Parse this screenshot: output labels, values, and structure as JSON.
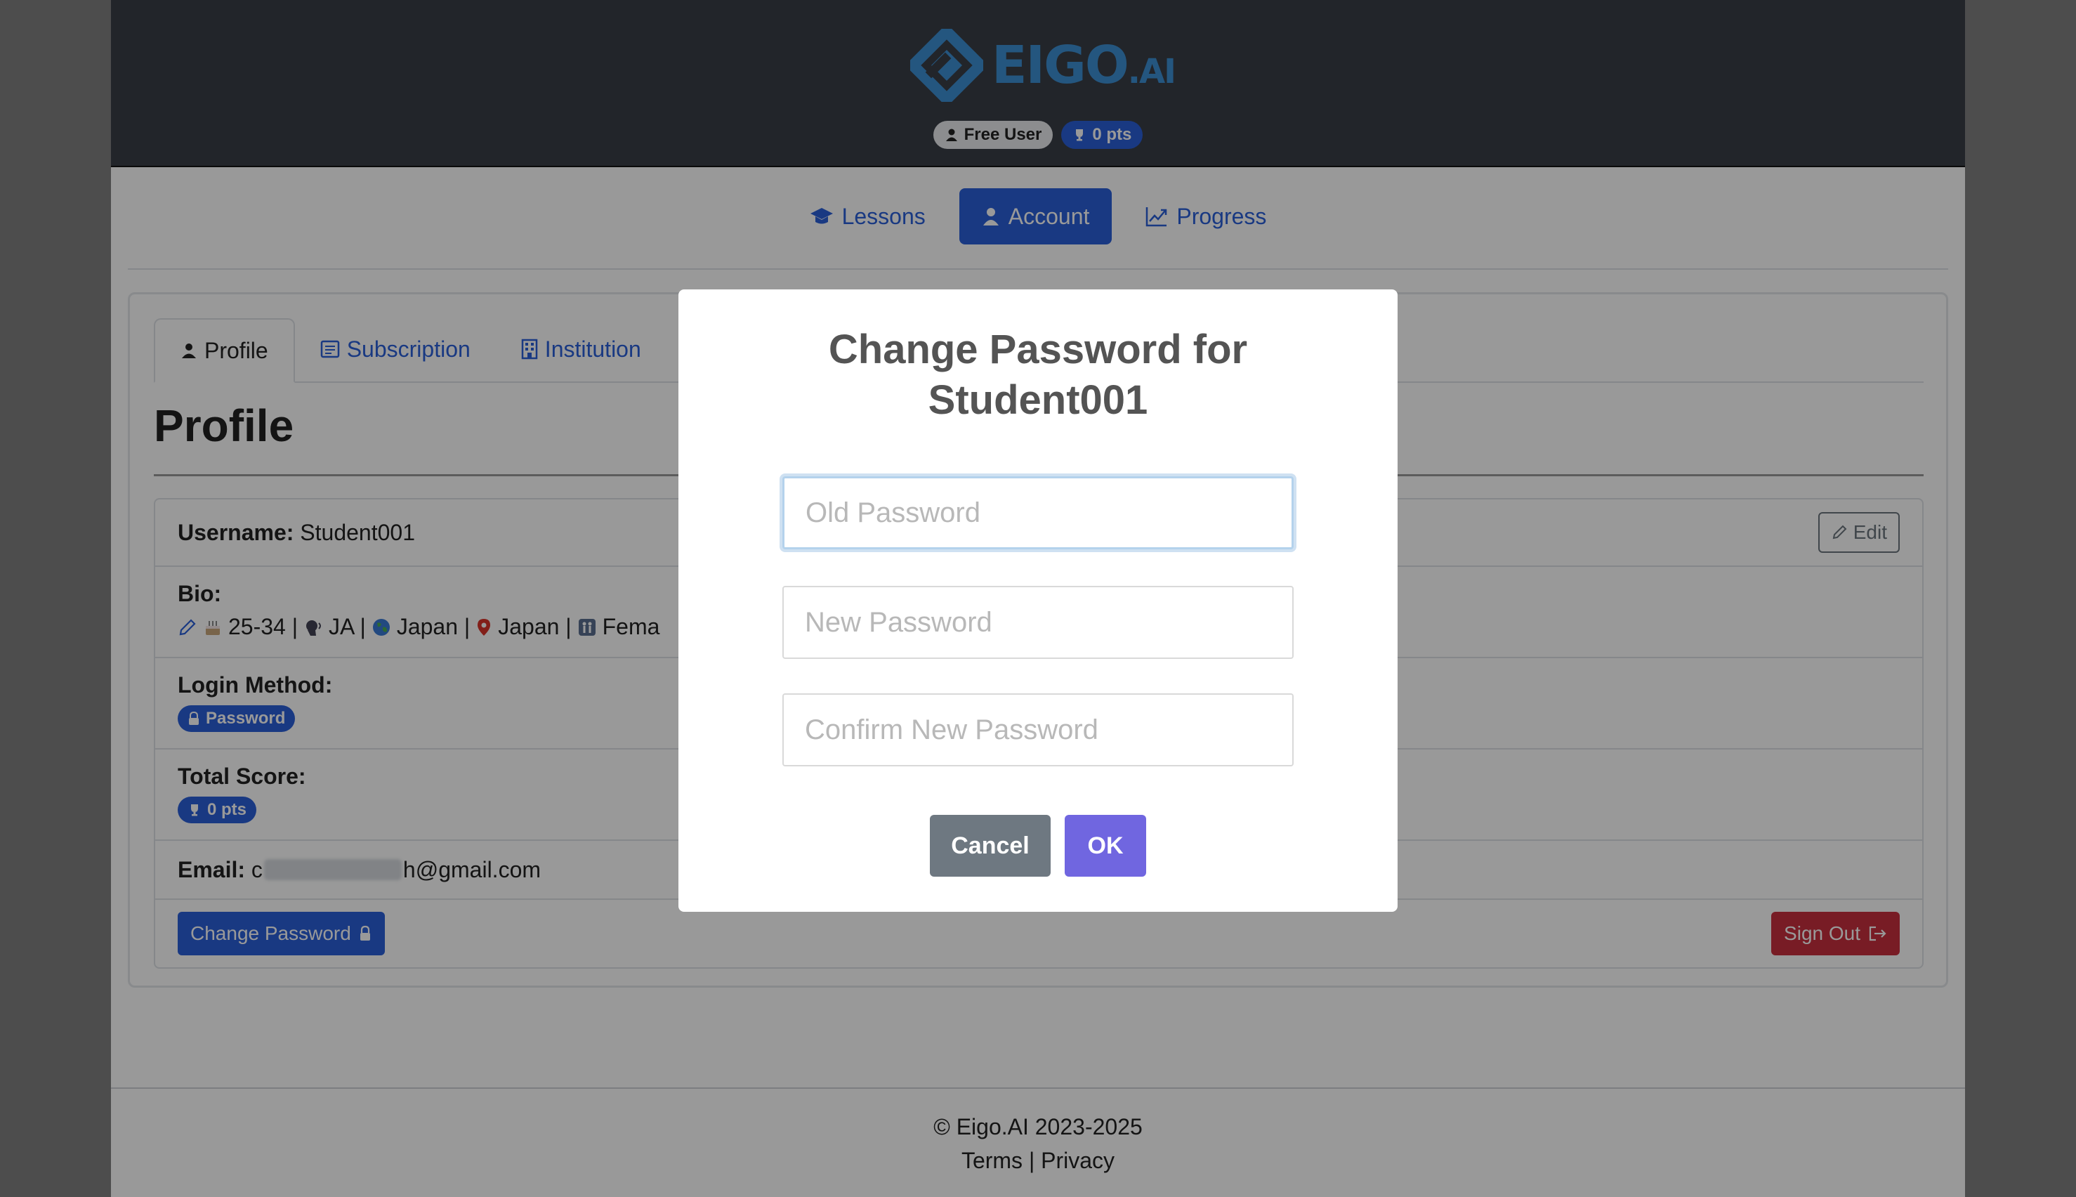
{
  "header": {
    "logo_main": "EIGO",
    "logo_suffix": ".AI",
    "badge_user": "Free User",
    "badge_points": "0 pts"
  },
  "nav": {
    "lessons": "Lessons",
    "account": "Account",
    "progress": "Progress"
  },
  "tabs": {
    "profile": "Profile",
    "subscription": "Subscription",
    "institution": "Institution"
  },
  "profile": {
    "title": "Profile",
    "username_label": "Username:",
    "username_value": "Student001",
    "edit_label": "Edit",
    "bio_label": "Bio:",
    "bio_age": "25-34 |",
    "bio_lang": "JA |",
    "bio_country": "Japan |",
    "bio_location": "Japan |",
    "bio_gender": "Fema",
    "login_label": "Login Method:",
    "login_value": "Password",
    "score_label": "Total Score:",
    "score_value": "0 pts",
    "email_label": "Email:",
    "email_start": "c",
    "email_end": "h@gmail.com",
    "change_password": "Change Password",
    "sign_out": "Sign Out"
  },
  "footer": {
    "copyright": "© Eigo.AI 2023-2025",
    "terms": "Terms",
    "separator": "|",
    "privacy": "Privacy"
  },
  "modal": {
    "title_line1": "Change Password for",
    "title_line2": "Student001",
    "old_password_placeholder": "Old Password",
    "new_password_placeholder": "New Password",
    "confirm_password_placeholder": "Confirm New Password",
    "cancel": "Cancel",
    "ok": "OK"
  },
  "colors": {
    "primary": "#2b5fd9",
    "danger": "#c9303e",
    "modal_ok": "#7066e0",
    "modal_cancel": "#6e7881",
    "logo": "#3d8fd4"
  }
}
